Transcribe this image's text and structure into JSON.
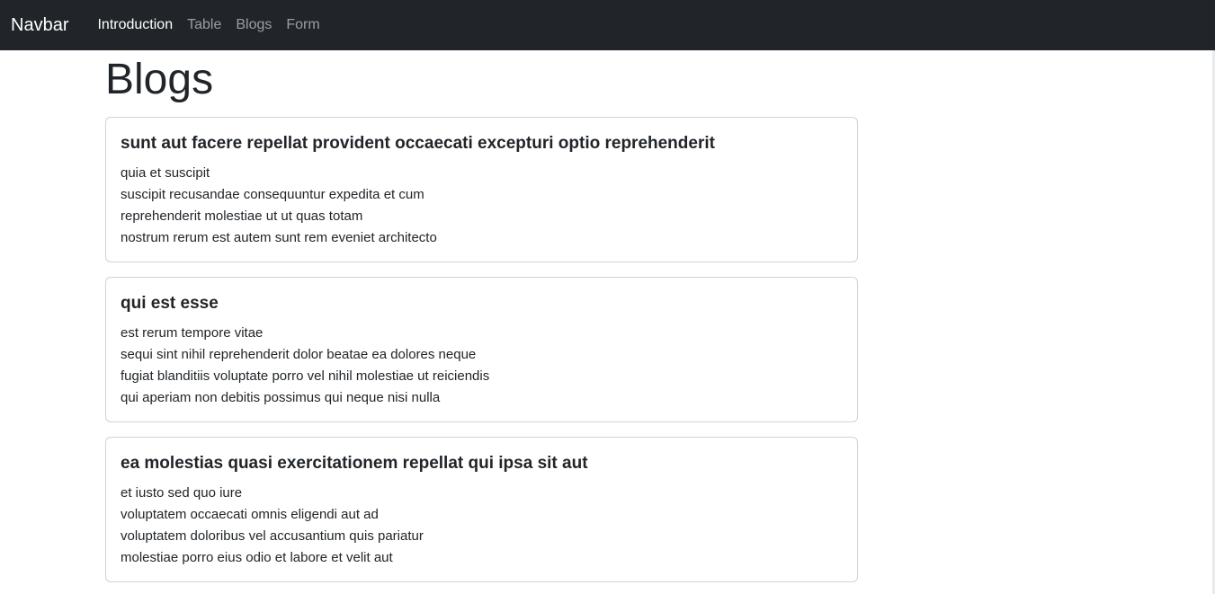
{
  "navbar": {
    "brand": "Navbar",
    "links": [
      {
        "label": "Introduction",
        "active": true
      },
      {
        "label": "Table",
        "active": false
      },
      {
        "label": "Blogs",
        "active": false
      },
      {
        "label": "Form",
        "active": false
      }
    ]
  },
  "page": {
    "title": "Blogs"
  },
  "posts": [
    {
      "title": "sunt aut facere repellat provident occaecati excepturi optio reprehenderit",
      "body": [
        "quia et suscipit",
        "suscipit recusandae consequuntur expedita et cum",
        "reprehenderit molestiae ut ut quas totam",
        "nostrum rerum est autem sunt rem eveniet architecto"
      ]
    },
    {
      "title": "qui est esse",
      "body": [
        "est rerum tempore vitae",
        "sequi sint nihil reprehenderit dolor beatae ea dolores neque",
        "fugiat blanditiis voluptate porro vel nihil molestiae ut reiciendis",
        "qui aperiam non debitis possimus qui neque nisi nulla"
      ]
    },
    {
      "title": "ea molestias quasi exercitationem repellat qui ipsa sit aut",
      "body": [
        "et iusto sed quo iure",
        "voluptatem occaecati omnis eligendi aut ad",
        "voluptatem doloribus vel accusantium quis pariatur",
        "molestiae porro eius odio et labore et velit aut"
      ]
    }
  ]
}
